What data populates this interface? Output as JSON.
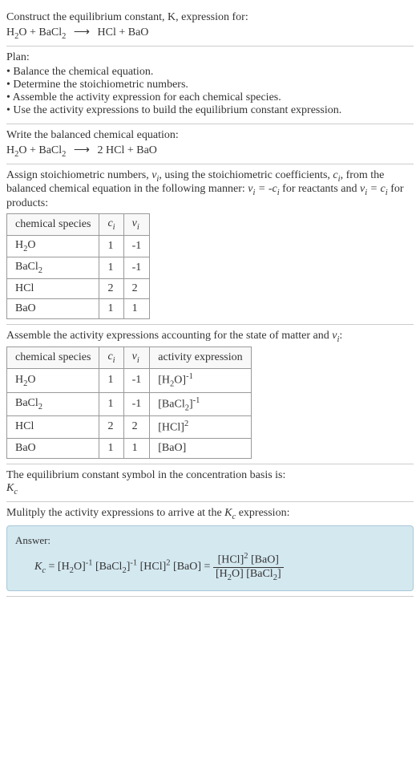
{
  "header": {
    "prompt": "Construct the equilibrium constant, K, expression for:",
    "equation_left": "H₂O + BaCl₂",
    "equation_arrow": "⟶",
    "equation_right": "HCl + BaO"
  },
  "plan": {
    "title": "Plan:",
    "items": [
      "Balance the chemical equation.",
      "Determine the stoichiometric numbers.",
      "Assemble the activity expression for each chemical species.",
      "Use the activity expressions to build the equilibrium constant expression."
    ]
  },
  "balanced": {
    "title": "Write the balanced chemical equation:",
    "equation_left": "H₂O + BaCl₂",
    "equation_arrow": "⟶",
    "equation_right": "2 HCl + BaO"
  },
  "stoich": {
    "intro_part1": "Assign stoichiometric numbers, ",
    "intro_nu": "νᵢ",
    "intro_part2": ", using the stoichiometric coefficients, ",
    "intro_c": "cᵢ",
    "intro_part3": ", from the balanced chemical equation in the following manner: ",
    "intro_eq1": "νᵢ = -cᵢ",
    "intro_part4": " for reactants and ",
    "intro_eq2": "νᵢ = cᵢ",
    "intro_part5": " for products:",
    "headers": [
      "chemical species",
      "cᵢ",
      "νᵢ"
    ],
    "rows": [
      {
        "species": "H₂O",
        "c": "1",
        "nu": "-1"
      },
      {
        "species": "BaCl₂",
        "c": "1",
        "nu": "-1"
      },
      {
        "species": "HCl",
        "c": "2",
        "nu": "2"
      },
      {
        "species": "BaO",
        "c": "1",
        "nu": "1"
      }
    ]
  },
  "activity": {
    "intro_part1": "Assemble the activity expressions accounting for the state of matter and ",
    "intro_nu": "νᵢ",
    "intro_part2": ":",
    "headers": [
      "chemical species",
      "cᵢ",
      "νᵢ",
      "activity expression"
    ],
    "rows": [
      {
        "species": "H₂O",
        "c": "1",
        "nu": "-1",
        "expr_base": "[H₂O]",
        "expr_sup": "-1"
      },
      {
        "species": "BaCl₂",
        "c": "1",
        "nu": "-1",
        "expr_base": "[BaCl₂]",
        "expr_sup": "-1"
      },
      {
        "species": "HCl",
        "c": "2",
        "nu": "2",
        "expr_base": "[HCl]",
        "expr_sup": "2"
      },
      {
        "species": "BaO",
        "c": "1",
        "nu": "1",
        "expr_base": "[BaO]",
        "expr_sup": ""
      }
    ]
  },
  "symbol": {
    "text": "The equilibrium constant symbol in the concentration basis is:",
    "sym": "K",
    "sym_sub": "c"
  },
  "multiply": {
    "text_part1": "Mulitply the activity expressions to arrive at the ",
    "sym": "K",
    "sym_sub": "c",
    "text_part2": " expression:"
  },
  "answer": {
    "label": "Answer:",
    "kc": "K",
    "kc_sub": "c",
    "eq": " = ",
    "term1_base": "[H₂O]",
    "term1_sup": "-1",
    "term2_base": " [BaCl₂]",
    "term2_sup": "-1",
    "term3_base": " [HCl]",
    "term3_sup": "2",
    "term4_base": " [BaO]",
    "eq2": " = ",
    "num1_base": "[HCl]",
    "num1_sup": "2",
    "num2": " [BaO]",
    "den1": "[H₂O] ",
    "den2": "[BaCl₂]"
  }
}
